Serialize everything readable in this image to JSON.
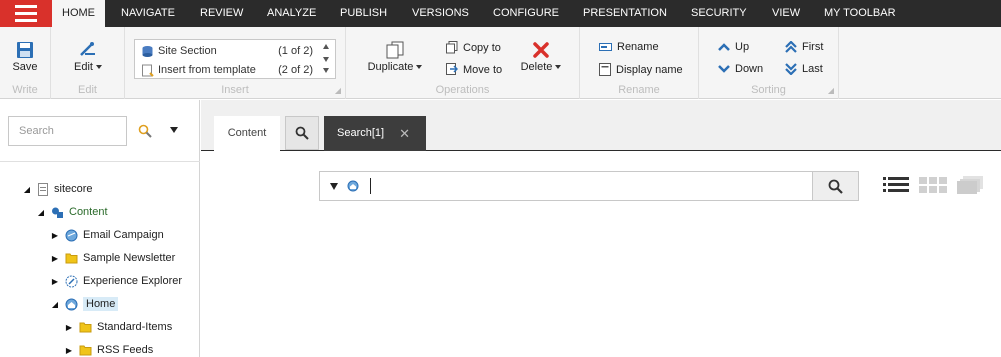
{
  "menu": {
    "tabs": [
      "HOME",
      "NAVIGATE",
      "REVIEW",
      "ANALYZE",
      "PUBLISH",
      "VERSIONS",
      "CONFIGURE",
      "PRESENTATION",
      "SECURITY",
      "VIEW",
      "MY TOOLBAR"
    ],
    "active": "HOME"
  },
  "ribbon": {
    "write": {
      "label": "Write",
      "save": "Save"
    },
    "edit": {
      "label": "Edit",
      "edit": "Edit"
    },
    "insert": {
      "label": "Insert",
      "items": [
        {
          "label": "Site Section",
          "count": "(1 of 2)"
        },
        {
          "label": "Insert from template",
          "count": "(2 of 2)"
        }
      ]
    },
    "operations": {
      "label": "Operations",
      "duplicate": "Duplicate",
      "copy_to": "Copy to",
      "move_to": "Move to",
      "delete": "Delete"
    },
    "rename": {
      "label": "Rename",
      "rename": "Rename",
      "display_name": "Display name"
    },
    "sorting": {
      "label": "Sorting",
      "up": "Up",
      "down": "Down",
      "first": "First",
      "last": "Last"
    }
  },
  "left": {
    "search_placeholder": "Search",
    "tree": [
      {
        "label": "sitecore",
        "expander": "◢"
      },
      {
        "label": "Content",
        "expander": "◢"
      },
      {
        "label": "Email Campaign",
        "expander": "▶"
      },
      {
        "label": "Sample Newsletter",
        "expander": "▶"
      },
      {
        "label": "Experience Explorer",
        "expander": "▶"
      },
      {
        "label": "Home",
        "expander": "◢"
      },
      {
        "label": "Standard-Items",
        "expander": "▶"
      },
      {
        "label": "RSS Feeds",
        "expander": "▶"
      }
    ]
  },
  "right": {
    "tabs": {
      "content": "Content",
      "search_tab": "Search[1]",
      "close": "✕"
    },
    "search_value": ""
  },
  "colors": {
    "menu_bg": "#2b2b2b",
    "accent_red": "#d9312b",
    "icon_blue": "#2c6fb5"
  }
}
